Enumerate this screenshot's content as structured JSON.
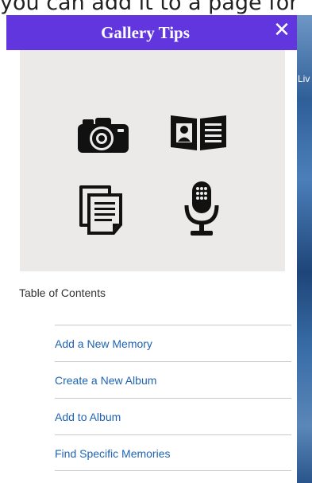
{
  "background": {
    "top_text": "you can add it to a page for",
    "photo_label": "Liv"
  },
  "panel": {
    "title": "Gallery Tips",
    "close_glyph": "✕",
    "accent_color": "#6136df",
    "hero_icons": [
      "camera-icon",
      "photo-album-icon",
      "document-stack-icon",
      "microphone-icon"
    ]
  },
  "toc": {
    "heading": "Table of Contents",
    "items": [
      {
        "label": "Add a New Memory"
      },
      {
        "label": "Create a New Album"
      },
      {
        "label": "Add to Album"
      },
      {
        "label": "Find Specific Memories"
      }
    ],
    "link_color": "#1e63b4"
  }
}
